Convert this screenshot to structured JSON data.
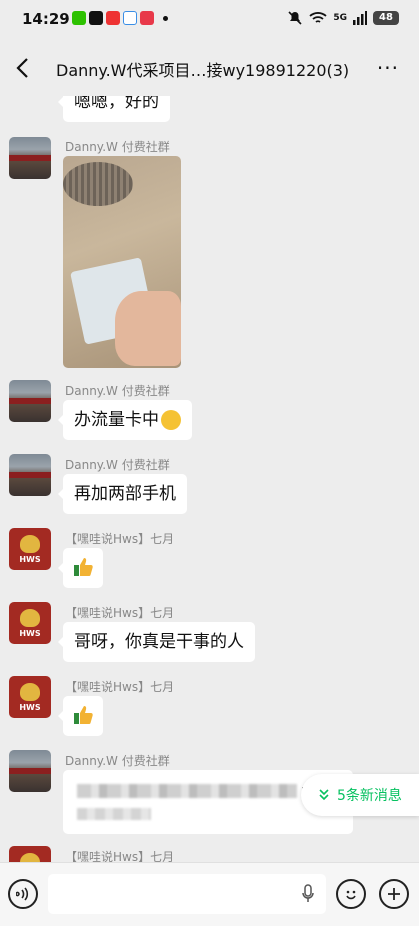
{
  "status_bar": {
    "time": "14:29",
    "network": "5G",
    "battery": "48"
  },
  "header": {
    "title": "Danny.W代采项目…接wy19891220(3)"
  },
  "messages": [
    {
      "sender": "",
      "text": "嗯嗯，好的"
    },
    {
      "sender": "Danny.W  付费社群",
      "kind": "image"
    },
    {
      "sender": "Danny.W  付费社群",
      "text": "办流量卡中"
    },
    {
      "sender": "Danny.W  付费社群",
      "text": "再加两部手机"
    },
    {
      "sender": "【嘿哇说Hws】七月",
      "kind": "thumbs-up-emoji"
    },
    {
      "sender": "【嘿哇说Hws】七月",
      "text": "哥呀，你真是干事的人"
    },
    {
      "sender": "【嘿哇说Hws】七月",
      "kind": "thumbs-up-emoji"
    },
    {
      "sender": "Danny.W  付费社群",
      "text": "才"
    },
    {
      "sender": "【嘿哇说Hws】七月"
    }
  ],
  "new_messages_badge": "5条新消息",
  "avatar_logo_text": "HWS",
  "colors": {
    "accent": "#07c160",
    "background": "#ededed",
    "bubble": "#ffffff"
  }
}
